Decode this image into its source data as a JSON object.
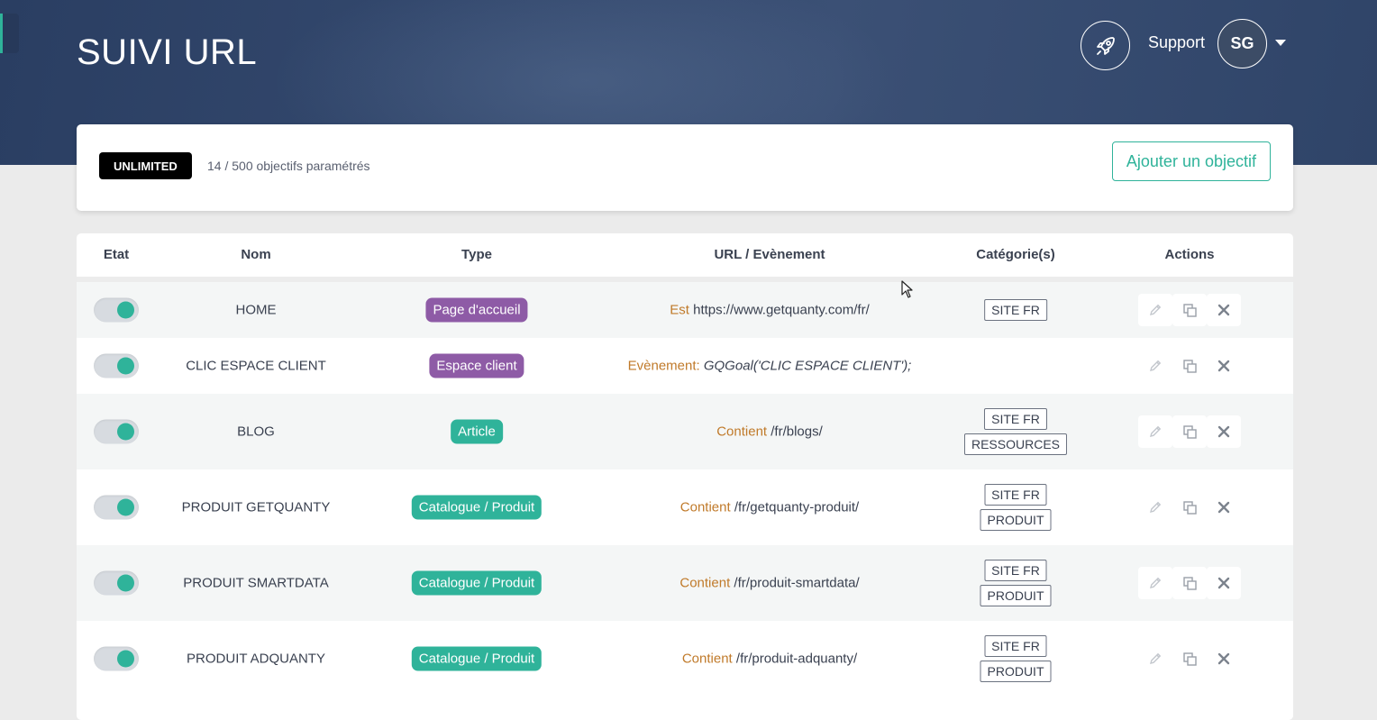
{
  "header": {
    "title": "SUIVI URL",
    "support_label": "Support",
    "avatar_initials": "SG"
  },
  "summary": {
    "plan": "UNLIMITED",
    "objectives_count": "14 / 500 objectifs paramétrés",
    "add_button": "Ajouter un objectif"
  },
  "colors": {
    "accent": "#2fb39a",
    "purple_pill": "#8e5ba6",
    "teal_pill": "#2fb39a",
    "operator": "#c07a2a",
    "header_bg": "#2f4468"
  },
  "table": {
    "columns": [
      "Etat",
      "Nom",
      "Type",
      "URL / Evènement",
      "Catégorie(s)",
      "Actions"
    ],
    "rows": [
      {
        "name": "HOME",
        "type": "Page d'accueil",
        "type_color": "purple",
        "url_op": "Est",
        "url_value": "https://www.getquanty.com/fr/",
        "url_italic": false,
        "categories": [
          "SITE FR"
        ],
        "active": true
      },
      {
        "name": "CLIC ESPACE CLIENT",
        "type": "Espace client",
        "type_color": "purple",
        "url_op": "Evènement:",
        "url_value": "GQGoal('CLIC ESPACE CLIENT');",
        "url_italic": true,
        "categories": [],
        "active": true
      },
      {
        "name": "BLOG",
        "type": "Article",
        "type_color": "teal",
        "url_op": "Contient",
        "url_value": "/fr/blogs/",
        "url_italic": false,
        "categories": [
          "SITE FR",
          "RESSOURCES"
        ],
        "active": true
      },
      {
        "name": "PRODUIT GETQUANTY",
        "type": "Catalogue / Produit",
        "type_color": "teal",
        "url_op": "Contient",
        "url_value": "/fr/getquanty-produit/",
        "url_italic": false,
        "categories": [
          "SITE FR",
          "PRODUIT"
        ],
        "active": true
      },
      {
        "name": "PRODUIT SMARTDATA",
        "type": "Catalogue / Produit",
        "type_color": "teal",
        "url_op": "Contient",
        "url_value": "/fr/produit-smartdata/",
        "url_italic": false,
        "categories": [
          "SITE FR",
          "PRODUIT"
        ],
        "active": true
      },
      {
        "name": "PRODUIT ADQUANTY",
        "type": "Catalogue / Produit",
        "type_color": "teal",
        "url_op": "Contient",
        "url_value": "/fr/produit-adquanty/",
        "url_italic": false,
        "categories": [
          "SITE FR",
          "PRODUIT"
        ],
        "active": true
      }
    ],
    "action_icons": [
      "pencil-icon",
      "duplicate-icon",
      "close-icon"
    ]
  }
}
